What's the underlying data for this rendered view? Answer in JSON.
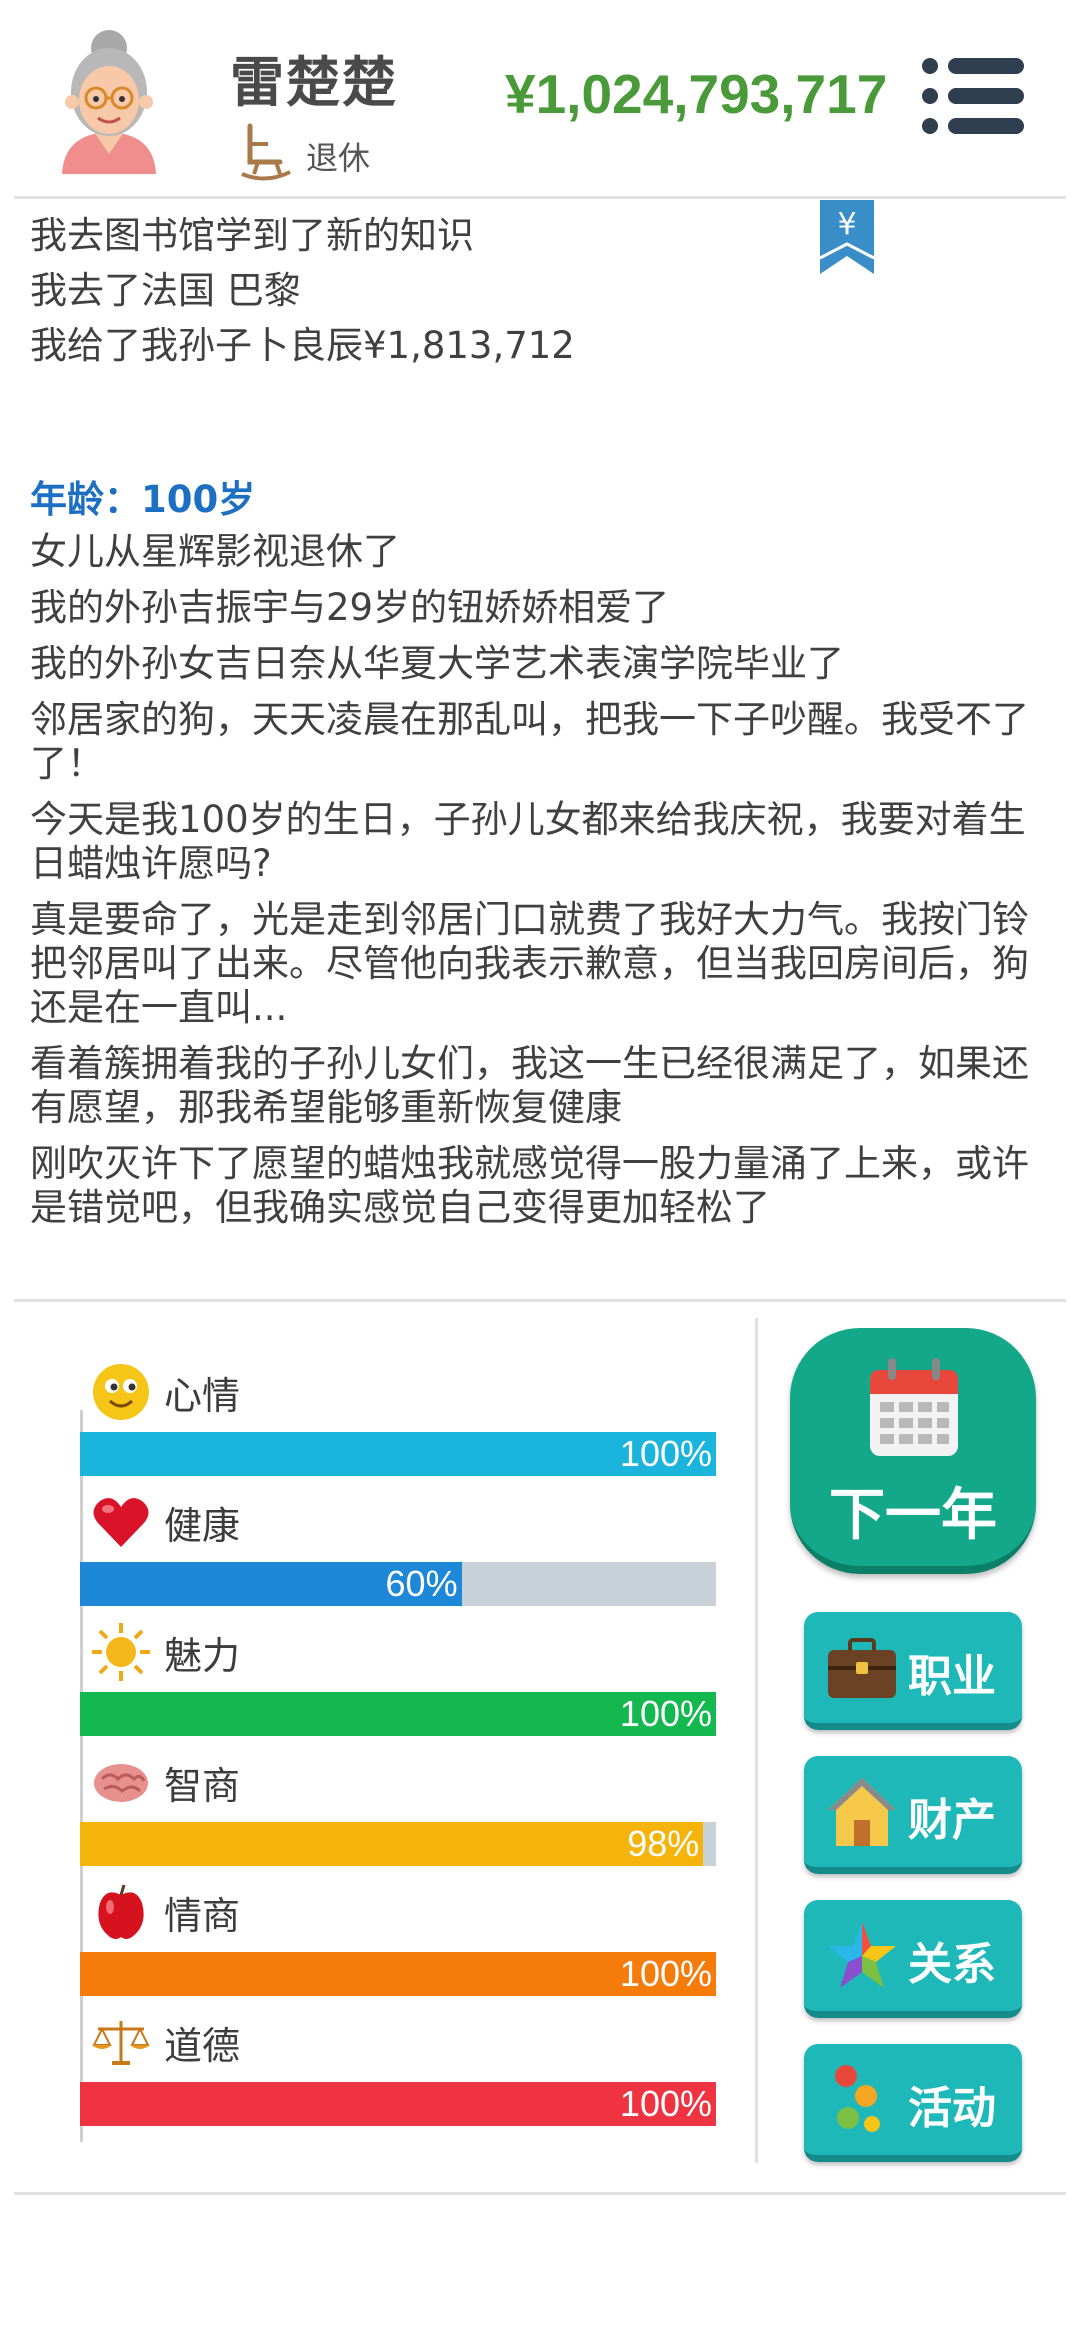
{
  "header": {
    "name": "雷楚楚",
    "status": "退休",
    "money": "¥1,024,793,717"
  },
  "log_top": [
    "我去图书馆学到了新的知识",
    "我去了法国 巴黎",
    "我给了我孙子卜良辰¥1,813,712"
  ],
  "bookmark_symbol": "¥",
  "age_label": "年龄：100岁",
  "events": [
    "女儿从星辉影视退休了",
    "我的外孙吉振宇与29岁的钮娇娇相爱了",
    "我的外孙女吉日奈从华夏大学艺术表演学院毕业了",
    "邻居家的狗，天天凌晨在那乱叫，把我一下子吵醒。我受不了了！",
    "今天是我100岁的生日，子孙儿女都来给我庆祝，我要对着生日蜡烛许愿吗?",
    "真是要命了，光是走到邻居门口就费了我好大力气。我按门铃把邻居叫了出来。尽管他向我表示歉意，但当我回房间后，狗还是在一直叫...",
    "看着簇拥着我的子孙儿女们，我这一生已经很满足了，如果还有愿望，那我希望能够重新恢复健康",
    "刚吹灭许下了愿望的蜡烛我就感觉得一股力量涌了上来，或许是错觉吧，但我确实感觉自己变得更加轻松了"
  ],
  "stats": [
    {
      "label": "心情",
      "percent": 100,
      "percent_text": "100%",
      "color": "#1ab4dc",
      "icon": "smiley-icon"
    },
    {
      "label": "健康",
      "percent": 60,
      "percent_text": "60%",
      "color": "#1e88d8",
      "icon": "heart-icon"
    },
    {
      "label": "魅力",
      "percent": 100,
      "percent_text": "100%",
      "color": "#13b84e",
      "icon": "sun-icon"
    },
    {
      "label": "智商",
      "percent": 98,
      "percent_text": "98%",
      "color": "#f5b40c",
      "icon": "brain-icon"
    },
    {
      "label": "情商",
      "percent": 100,
      "percent_text": "100%",
      "color": "#f57c0a",
      "icon": "apple-icon"
    },
    {
      "label": "道德",
      "percent": 100,
      "percent_text": "100%",
      "color": "#ef3340",
      "icon": "scales-icon"
    }
  ],
  "buttons": {
    "next_year": "下一年",
    "career": "职业",
    "property": "财产",
    "relations": "关系",
    "activities": "活动"
  },
  "colors": {
    "money": "#4a9a3a",
    "age": "#1d6fc4",
    "next_year_bg": "#14a88a",
    "side_button_bg": "#1fb8b8"
  }
}
